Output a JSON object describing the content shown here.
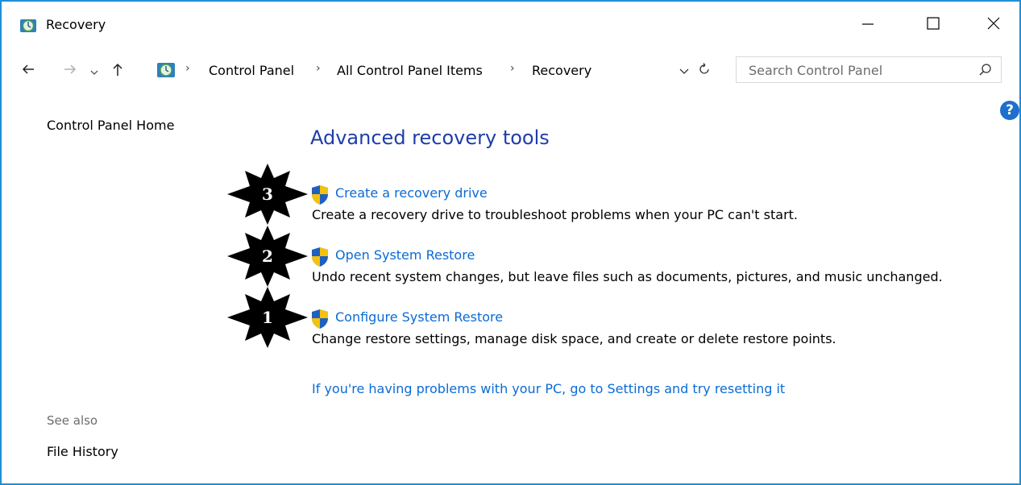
{
  "window": {
    "title": "Recovery"
  },
  "titlebar": {
    "minimize": "minimize",
    "maximize": "maximize",
    "close": "close"
  },
  "breadcrumb": [
    "Control Panel",
    "All Control Panel Items",
    "Recovery"
  ],
  "search": {
    "placeholder": "Search Control Panel"
  },
  "sidebar": {
    "home": "Control Panel Home",
    "see_also": "See also",
    "file_history": "File History"
  },
  "main": {
    "heading": "Advanced recovery tools",
    "items": [
      {
        "link": "Create a recovery drive",
        "description": "Create a recovery drive to troubleshoot problems when your PC can't start."
      },
      {
        "link": "Open System Restore",
        "description": "Undo recent system changes, but leave files such as documents, pictures, and music unchanged."
      },
      {
        "link": "Configure System Restore",
        "description": "Change restore settings, manage disk space, and create or delete restore points."
      }
    ],
    "reset_link": "If you're having problems with your PC, go to Settings and try resetting it"
  },
  "badges": [
    "3",
    "2",
    "1"
  ],
  "help": "?",
  "colors": {
    "accent": "#1f8fd6",
    "link": "#0a6bd6",
    "heading": "#1e3da8",
    "help": "#1e70cd"
  }
}
